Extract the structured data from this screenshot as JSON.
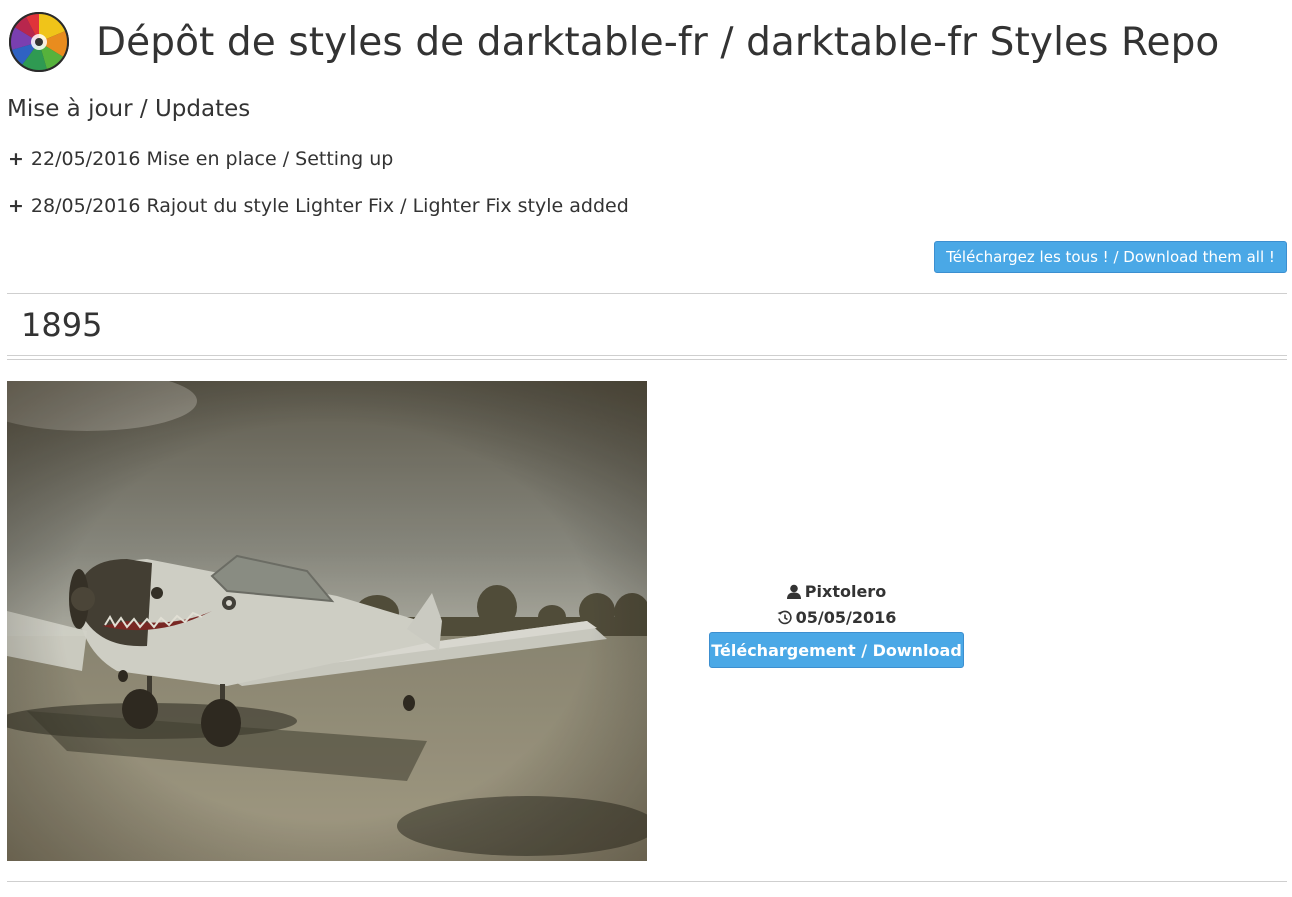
{
  "site": {
    "title": "Dépôt de styles de darktable-fr / darktable-fr Styles Repo",
    "logo_icon": "darktable-aperture-logo"
  },
  "updates": {
    "title": "Mise à jour / Updates",
    "bullet": "+",
    "items": [
      {
        "text": "22/05/2016 Mise en place / Setting up"
      },
      {
        "text": "28/05/2016 Rajout du style Lighter Fix / Lighter Fix style added"
      }
    ]
  },
  "download_all_label": "Téléchargez les tous ! / Download them all !",
  "style": {
    "name": "1895",
    "preview_icon": "sepia-airplane-photo",
    "author": "Pixtolero",
    "date": "05/05/2016",
    "download_label": "Téléchargement / Download"
  },
  "colors": {
    "button": "#4aa8e6",
    "text": "#333333",
    "divider": "#cfcfcf"
  }
}
